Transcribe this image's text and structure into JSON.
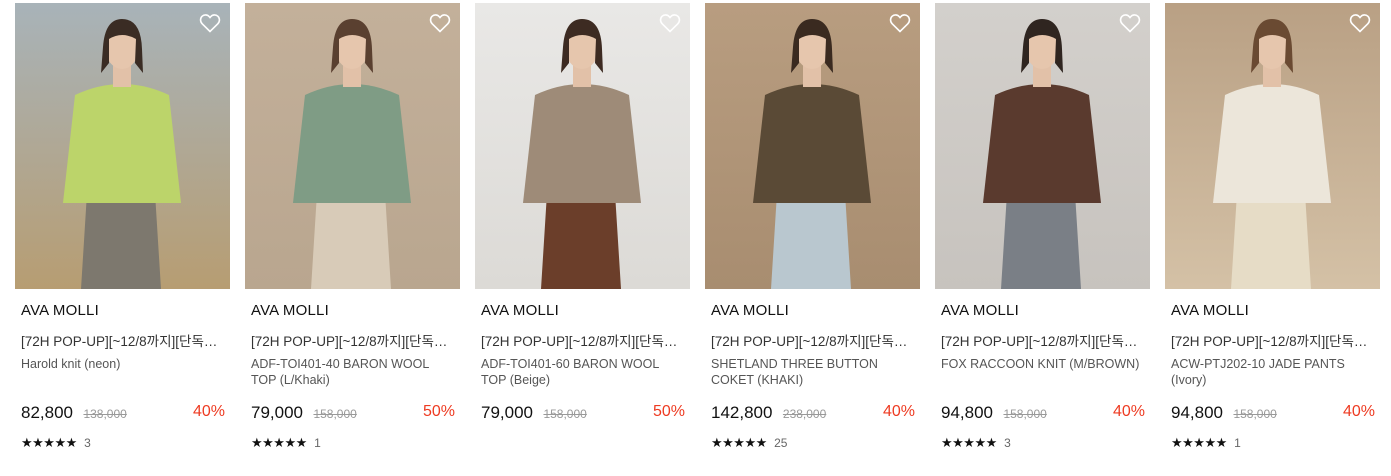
{
  "products": [
    {
      "brand": "AVA MOLLI",
      "promo": "[72H POP-UP][~12/8까지][단독…",
      "name": "Harold knit (neon)",
      "price": "82,800",
      "original_price": "138,000",
      "discount": "40%",
      "stars": "★★★★★",
      "review_count": "3",
      "photo": {
        "bg_top": "#a8b3b9",
        "bg_bottom": "#b79d72",
        "figure": "#bcd46a",
        "hair": "#3a2c24",
        "skirt": "#7d786e"
      }
    },
    {
      "brand": "AVA MOLLI",
      "promo": "[72H POP-UP][~12/8까지][단독…",
      "name": "ADF-TOI401-40 BARON WOOL TOP (L/Khaki)",
      "price": "79,000",
      "original_price": "158,000",
      "discount": "50%",
      "stars": "★★★★★",
      "review_count": "1",
      "photo": {
        "bg_top": "#c3b09a",
        "bg_bottom": "#b9a68f",
        "figure": "#7f9c85",
        "hair": "#5a4030",
        "skirt": "#d8cbb8"
      }
    },
    {
      "brand": "AVA MOLLI",
      "promo": "[72H POP-UP][~12/8까지][단독…",
      "name": "ADF-TOI401-60 BARON WOOL TOP (Beige)",
      "price": "79,000",
      "original_price": "158,000",
      "discount": "50%",
      "stars": "★★★★★",
      "review_count": "",
      "photo": {
        "bg_top": "#e9e8e6",
        "bg_bottom": "#dcdad6",
        "figure": "#9e8b78",
        "hair": "#3d2b22",
        "skirt": "#6b3e2a"
      }
    },
    {
      "brand": "AVA MOLLI",
      "promo": "[72H POP-UP][~12/8까지][단독…",
      "name": "SHETLAND THREE BUTTON COKET (KHAKI)",
      "price": "142,800",
      "original_price": "238,000",
      "discount": "40%",
      "stars": "★★★★★",
      "review_count": "25",
      "photo": {
        "bg_top": "#b89d80",
        "bg_bottom": "#a88d70",
        "figure": "#5a4a36",
        "hair": "#3a2a20",
        "skirt": "#b9c7cf"
      }
    },
    {
      "brand": "AVA MOLLI",
      "promo": "[72H POP-UP][~12/8까지][단독…",
      "name": "FOX RACCOON KNIT (M/BROWN)",
      "price": "94,800",
      "original_price": "158,000",
      "discount": "40%",
      "stars": "★★★★★",
      "review_count": "3",
      "photo": {
        "bg_top": "#d3d0cc",
        "bg_bottom": "#c7c3be",
        "figure": "#5a3a2e",
        "hair": "#2f2520",
        "skirt": "#7a7f86"
      }
    },
    {
      "brand": "AVA MOLLI",
      "promo": "[72H POP-UP][~12/8까지][단독…",
      "name": "ACW-PTJ202-10 JADE PANTS (Ivory)",
      "price": "94,800",
      "original_price": "158,000",
      "discount": "40%",
      "stars": "★★★★★",
      "review_count": "1",
      "photo": {
        "bg_top": "#b9a084",
        "bg_bottom": "#d4c1a6",
        "figure": "#ece6da",
        "hair": "#6a4a32",
        "skirt": "#e6dcc6"
      }
    }
  ],
  "colors": {
    "discount": "#ee3b22",
    "price": "#111111",
    "original_price": "#999999"
  },
  "icons": {
    "wishlist": "heart-outline-icon",
    "rating": "star-icon"
  }
}
